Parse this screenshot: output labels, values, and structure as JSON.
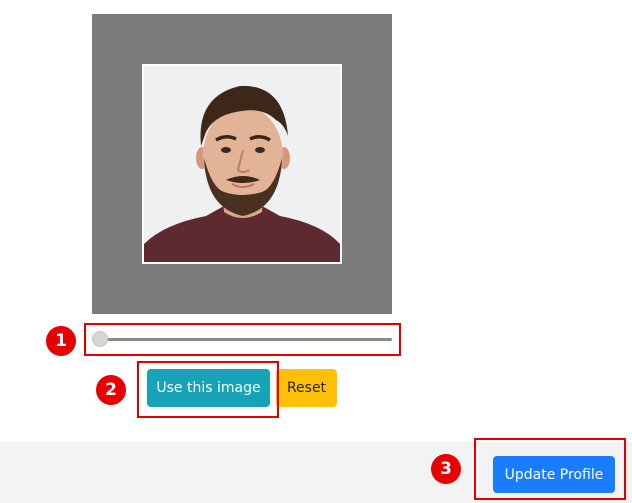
{
  "crop": {
    "image_alt": "profile photo of a bearded man"
  },
  "zoom_slider": {
    "value": 0
  },
  "buttons": {
    "use_image": "Use this image",
    "reset": "Reset",
    "update_profile": "Update Profile"
  },
  "annotations": {
    "one": "1",
    "two": "2",
    "three": "3"
  },
  "colors": {
    "crop_background": "#7b7b7b",
    "use_image_button": "#17a2b8",
    "reset_button": "#ffc107",
    "update_button": "#1a7cff",
    "highlight": "#e00000",
    "footer_background": "#f3f3f3"
  }
}
